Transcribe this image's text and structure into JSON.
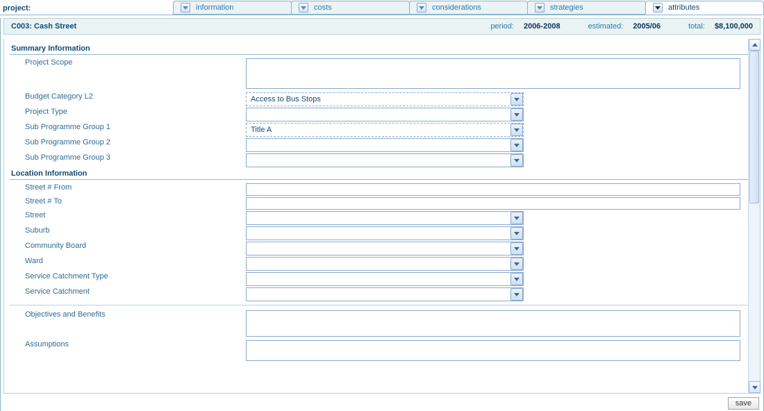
{
  "tabs": {
    "project_label": "project:",
    "items": [
      "information",
      "costs",
      "considerations",
      "strategies",
      "attributes"
    ],
    "active_index": 4
  },
  "header": {
    "title": "C003: Cash Street",
    "period_label": "period:",
    "period_value": "2006-2008",
    "estimated_label": "estimated:",
    "estimated_value": "2005/06",
    "total_label": "total:",
    "total_value": "$8,100,000"
  },
  "sections": {
    "summary": {
      "title": "Summary Information",
      "fields": [
        {
          "label": "Project Scope",
          "type": "textarea",
          "value": ""
        },
        {
          "label": "Budget Category L2",
          "type": "select",
          "value": "Access to Bus Stops"
        },
        {
          "label": "Project Type",
          "type": "select",
          "value": ""
        },
        {
          "label": "Sub Programme Group 1",
          "type": "select",
          "value": "Title A"
        },
        {
          "label": "Sub Programme Group 2",
          "type": "select",
          "value": ""
        },
        {
          "label": "Sub Programme Group 3",
          "type": "select",
          "value": ""
        }
      ]
    },
    "location": {
      "title": "Location Information",
      "fields": [
        {
          "label": "Street # From",
          "type": "text",
          "value": ""
        },
        {
          "label": "Street # To",
          "type": "text",
          "value": ""
        },
        {
          "label": "Street",
          "type": "select",
          "value": ""
        },
        {
          "label": "Suburb",
          "type": "select",
          "value": ""
        },
        {
          "label": "Community Board",
          "type": "select",
          "value": ""
        },
        {
          "label": "Ward",
          "type": "select",
          "value": ""
        },
        {
          "label": "Service Catchment Type",
          "type": "select",
          "value": ""
        },
        {
          "label": "Service Catchment",
          "type": "select",
          "value": ""
        }
      ]
    },
    "other": {
      "fields": [
        {
          "label": "Objectives and Benefits",
          "type": "textarea",
          "value": ""
        },
        {
          "label": "Assumptions",
          "type": "textarea",
          "value": ""
        }
      ]
    }
  },
  "footer": {
    "save_label": "save"
  }
}
